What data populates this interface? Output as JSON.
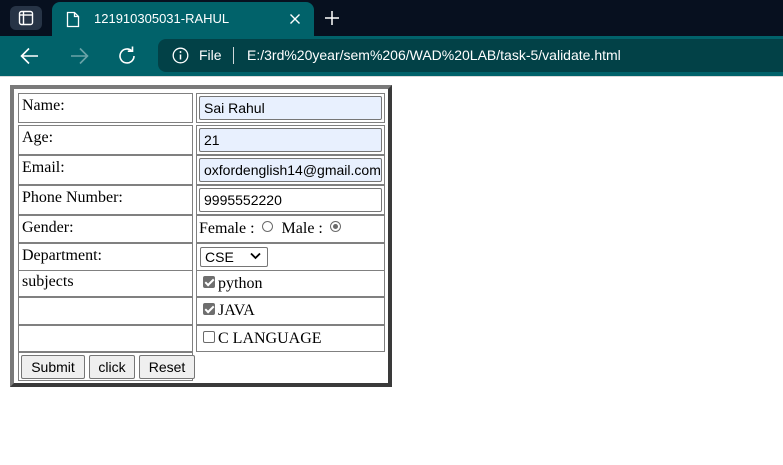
{
  "browser": {
    "tab_title": "121910305031-RAHUL",
    "omnibox_scheme": "File",
    "url": "E:/3rd%20year/sem%206/WAD%20LAB/task-5/validate.html"
  },
  "form": {
    "name": {
      "label": "Name:",
      "value": "Sai Rahul"
    },
    "age": {
      "label": "Age:",
      "value": "21"
    },
    "email": {
      "label": "Email:",
      "value": "oxfordenglish14@gmail.com"
    },
    "phone": {
      "label": "Phone Number:",
      "value": "9995552220"
    },
    "gender": {
      "label": "Gender:",
      "female_label": "Female :",
      "male_label": "Male :",
      "selected": "male"
    },
    "department": {
      "label": "Department:",
      "selected": "CSE"
    },
    "subjects": {
      "label": "subjects",
      "options": [
        {
          "label": "python",
          "checked": true
        },
        {
          "label": "JAVA",
          "checked": true
        },
        {
          "label": "C LANGUAGE",
          "checked": false
        }
      ]
    },
    "buttons": {
      "submit": "Submit",
      "click": "click",
      "reset": "Reset"
    }
  }
}
